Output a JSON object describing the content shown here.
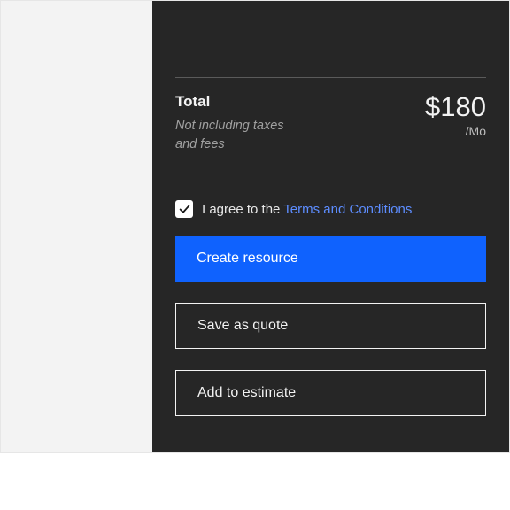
{
  "summary": {
    "total_label": "Total",
    "subtext": "Not including taxes and fees",
    "price": "$180",
    "price_unit": "/Mo"
  },
  "agree": {
    "checked": true,
    "prefix": "I agree to the ",
    "link_text": "Terms and Conditions"
  },
  "actions": {
    "primary": "Create resource",
    "secondary1": "Save as quote",
    "secondary2": "Add to estimate"
  }
}
